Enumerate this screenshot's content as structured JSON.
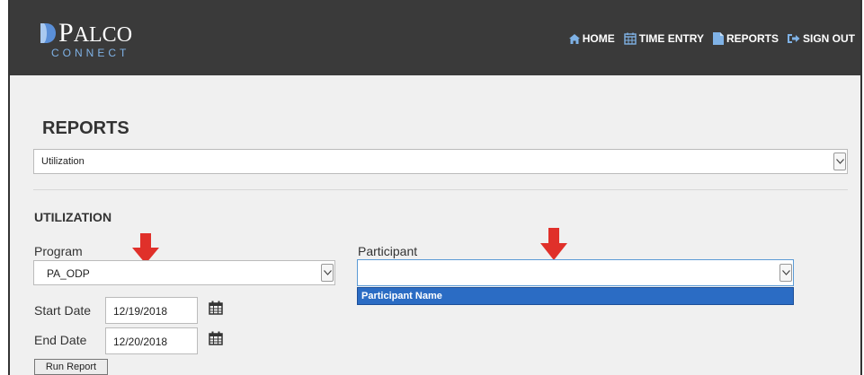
{
  "brand": {
    "name_first": "P",
    "name_rest": "ALCO",
    "subtitle": "CONNECT"
  },
  "nav": [
    {
      "label": "HOME",
      "icon": "home-icon"
    },
    {
      "label": "TIME ENTRY",
      "icon": "calendar-icon"
    },
    {
      "label": "REPORTS",
      "icon": "document-icon"
    },
    {
      "label": "SIGN OUT",
      "icon": "sign-out-icon"
    }
  ],
  "page": {
    "title": "REPORTS",
    "report_select_value": "Utilization"
  },
  "utilization": {
    "section_title": "UTILIZATION",
    "program_label": "Program",
    "program_value": "PA_ODP",
    "participant_label": "Participant",
    "participant_value": "",
    "participant_options": [
      "Participant Name"
    ],
    "start_date_label": "Start Date",
    "start_date_value": "12/19/2018",
    "end_date_label": "End Date",
    "end_date_value": "12/20/2018",
    "run_button": "Run Report"
  },
  "colors": {
    "header_bg": "#3a3a3a",
    "accent": "#2b6cc4",
    "annotation_arrow": "#e0302a",
    "nav_icon": "#7fb2e6"
  }
}
